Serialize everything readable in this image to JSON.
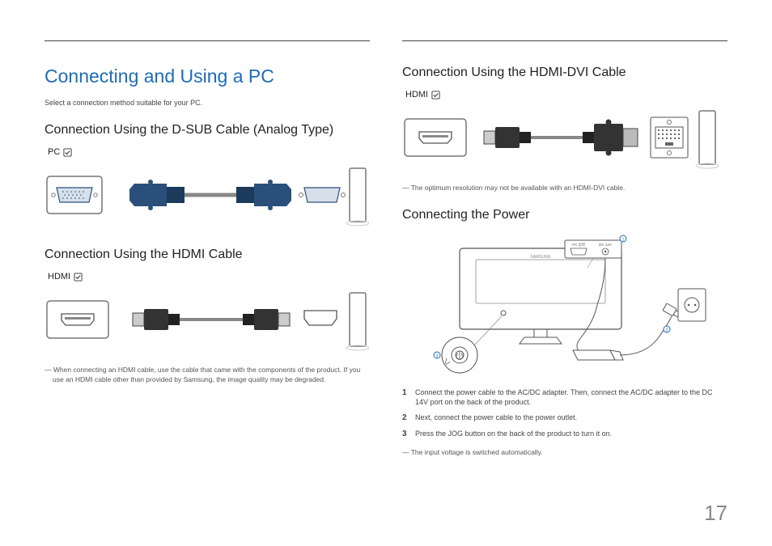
{
  "page_number": "17",
  "title": "Connecting and Using a PC",
  "intro": "Select a connection method suitable for your PC.",
  "left": {
    "dsub": {
      "heading": "Connection Using the D-SUB Cable (Analog Type)",
      "port_label": "PC"
    },
    "hdmi": {
      "heading": "Connection Using the HDMI Cable",
      "port_label": "HDMI",
      "note": "When connecting an HDMI cable, use the cable that came with the components of the product. If you use an HDMI cable other than provided by Samsung, the image quality may be degraded."
    }
  },
  "right": {
    "hdmi_dvi": {
      "heading": "Connection Using the HDMI-DVI Cable",
      "port_label": "HDMI",
      "note": "The optimum resolution may not be available with an HDMI-DVI cable."
    },
    "power": {
      "heading": "Connecting the Power",
      "back_panel": {
        "left_label": "PC 입력",
        "right_label": "DC 14V"
      },
      "steps": [
        "Connect the power cable to the AC/DC adapter. Then, connect the AC/DC adapter to the DC 14V port on the back of the product.",
        "Next, connect the power cable to the power outlet.",
        "Press the JOG button on the back of the product to turn it on."
      ],
      "note": "The input voltage is switched automatically."
    }
  }
}
